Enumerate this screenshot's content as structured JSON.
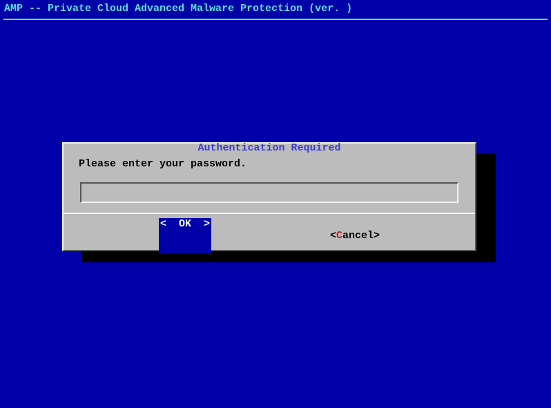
{
  "header": {
    "title": "AMP -- Private Cloud Advanced Malware Protection (ver. )"
  },
  "dialog": {
    "title": "Authentication Required",
    "prompt": "Please enter your password.",
    "password_value": "",
    "password_placeholder": "",
    "ok_label": "<  OK  >",
    "cancel_bracket_open": "<",
    "cancel_hotkey": "C",
    "cancel_rest": "ancel",
    "cancel_bracket_close": ">"
  }
}
